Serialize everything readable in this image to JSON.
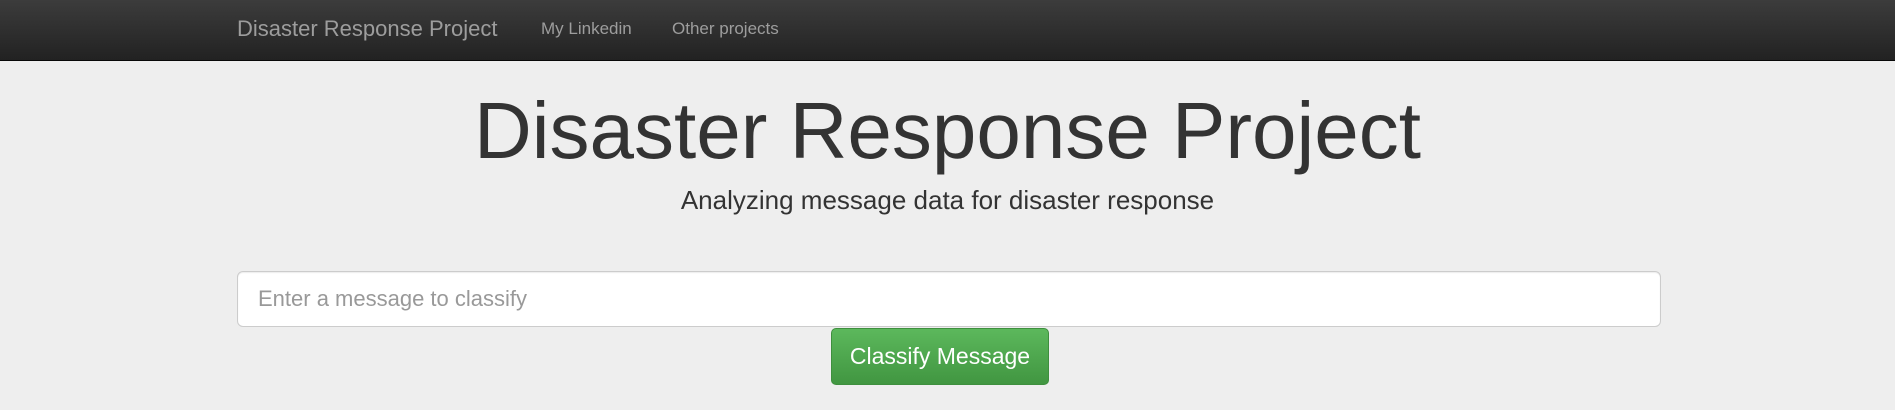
{
  "navbar": {
    "brand": "Disaster Response Project",
    "links": [
      {
        "label": "My Linkedin"
      },
      {
        "label": "Other projects"
      }
    ]
  },
  "main": {
    "title": "Disaster Response Project",
    "subtitle": "Analyzing message data for disaster response",
    "message_input": {
      "placeholder": "Enter a message to classify",
      "value": ""
    },
    "classify_button_label": "Classify Message"
  },
  "colors": {
    "navbar_background": "#222222",
    "navbar_text": "#9d9d9d",
    "page_background": "#eeeeee",
    "button_green": "#5cb85c"
  }
}
